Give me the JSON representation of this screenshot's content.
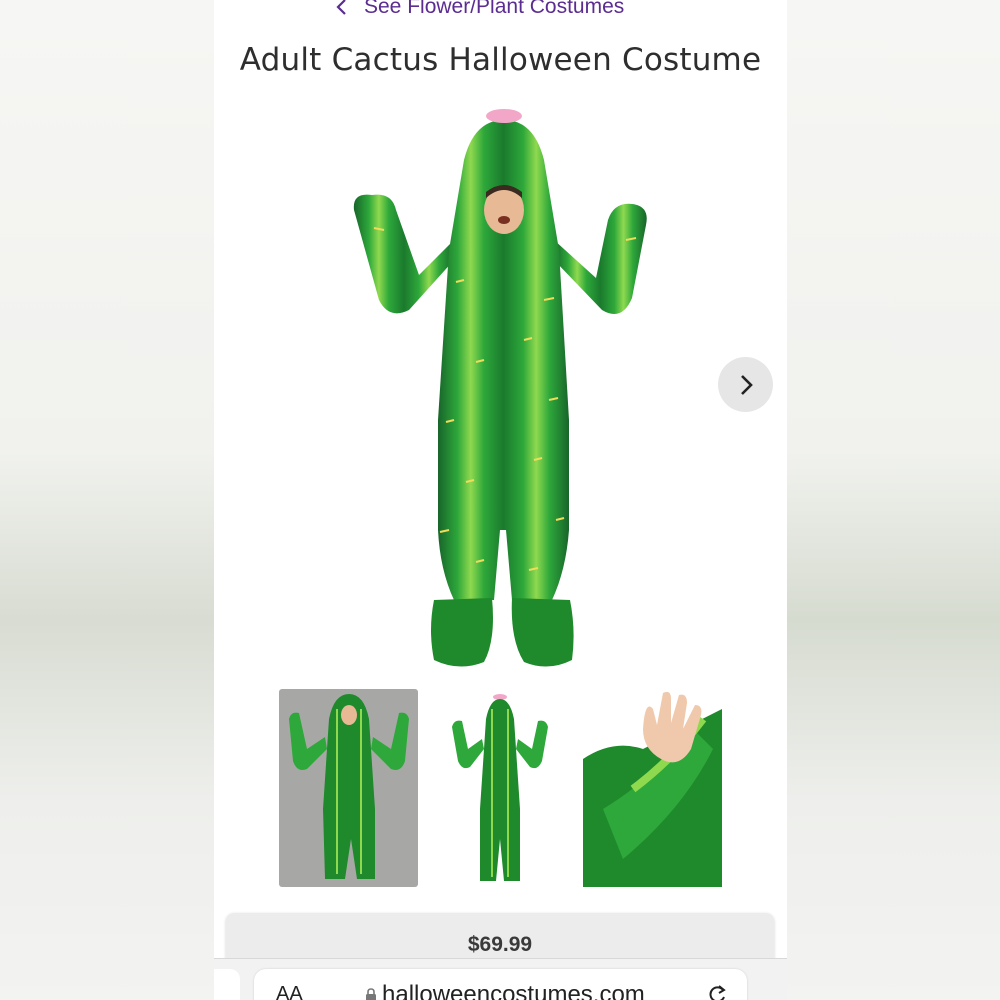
{
  "nav": {
    "back_label": "See Flower/Plant Costumes"
  },
  "product": {
    "title": "Adult Cactus Halloween Costume",
    "price": "$69.99"
  },
  "gallery": {
    "next_icon": "chevron-right-icon",
    "thumb_count": 3
  },
  "browser": {
    "text_size": "AA",
    "url": "halloweencostumes.com"
  },
  "colors": {
    "accent": "#5b2d91",
    "cactus": "#1f8a2b"
  }
}
